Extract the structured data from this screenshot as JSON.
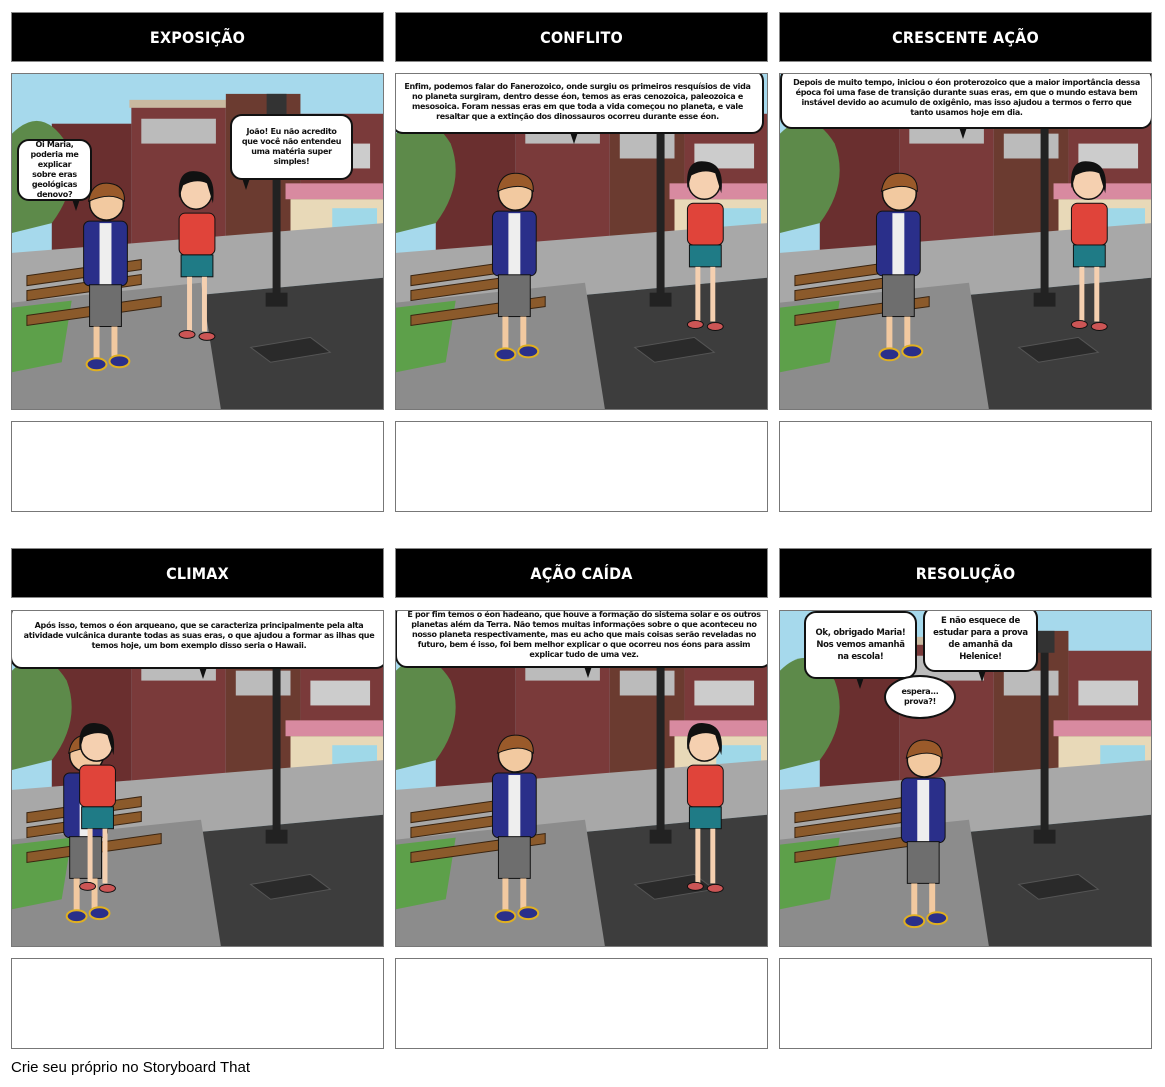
{
  "panels": [
    {
      "title": "EXPOSIÇÃO",
      "bubbles": [
        "Oi Maria, poderia me explicar sobre eras geológicas denovo?",
        "João! Eu não acredito que você não entendeu uma matéria super simples!"
      ],
      "caption": ""
    },
    {
      "title": "CONFLITO",
      "bubbles": [
        "Enfim, podemos falar do Fanerozoico, onde surgiu os primeiros resquísios de vida no planeta surgiram, dentro desse éon, temos as eras cenozoica, paleozoica e mesosoica. Foram nessas eras em que toda a vida começou no planeta, e vale resaltar que a extinção dos dinossauros ocorreu durante esse éon."
      ],
      "caption": ""
    },
    {
      "title": "CRESCENTE AÇÃO",
      "bubbles": [
        "Depois de muito tempo, iniciou o éon proterozoico que a maior importância dessa época foi uma fase de transição durante suas eras, em que o mundo estava bem instável devido ao acumulo de oxigênio, mas isso ajudou a termos o ferro que tanto usamos hoje em dia."
      ],
      "caption": ""
    },
    {
      "title": "CLIMAX",
      "bubbles": [
        "Após isso, temos o éon arqueano, que se caracteriza principalmente pela alta atividade vulcânica durante todas as suas eras, o que ajudou a formar as ilhas que temos hoje, um bom exemplo disso seria o Hawaii."
      ],
      "caption": ""
    },
    {
      "title": "AÇÃO CAÍDA",
      "bubbles": [
        "E por fim temos o éon hadeano, que houve a formação do sistema solar e os outros planetas além da Terra. Não temos muitas informações sobre o que aconteceu no nosso planeta respectivamente, mas eu acho que mais coisas serão reveladas no futuro, bem é isso, foi bem melhor explicar o que ocorreu nos éons para assim explicar tudo de uma vez."
      ],
      "caption": ""
    },
    {
      "title": "RESOLUÇÃO",
      "bubbles": [
        "Ok, obrigado Maria! Nos vemos amanhã na escola!",
        "E não esquece de estudar para a prova de amanhã da Helenice!",
        "espera... prova?!"
      ],
      "caption": ""
    }
  ],
  "footer": "Crie seu próprio no Storyboard That",
  "colors": {
    "header": "#000000",
    "sky": "#9fd6ea",
    "road": "#3a3a3a",
    "sidewalk": "#9a9a9a"
  }
}
